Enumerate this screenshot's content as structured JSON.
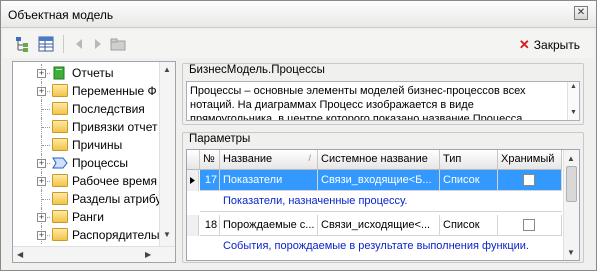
{
  "window": {
    "title": "Объектная модель",
    "close_glyph": "✕"
  },
  "toolbar": {
    "close_label": "Закрыть"
  },
  "tree": {
    "items": [
      {
        "label": "Отчеты",
        "icon": "green-book-icon",
        "expander": "+"
      },
      {
        "label": "Переменные Ф",
        "icon": "folder-icon",
        "expander": "+"
      },
      {
        "label": "Последствия",
        "icon": "folder-icon",
        "expander": ""
      },
      {
        "label": "Привязки отчет",
        "icon": "folder-icon",
        "expander": ""
      },
      {
        "label": "Причины",
        "icon": "folder-icon",
        "expander": ""
      },
      {
        "label": "Процессы",
        "icon": "process-arrow-icon",
        "expander": "+"
      },
      {
        "label": "Рабочее время",
        "icon": "folder-icon",
        "expander": "+"
      },
      {
        "label": "Разделы атрибу",
        "icon": "folder-icon",
        "expander": ""
      },
      {
        "label": "Ранги",
        "icon": "folder-icon",
        "expander": "+"
      },
      {
        "label": "Распорядителы",
        "icon": "folder-icon",
        "expander": "+"
      }
    ]
  },
  "description": {
    "title": "БизнесМодель.Процессы",
    "text": "Процессы – основные элементы моделей бизнес-процессов всех нотаций. На диаграммах Процесс изображается в виде прямоугольника, в центре которого показано название Процесса."
  },
  "params": {
    "title": "Параметры",
    "columns": [
      "№",
      "Название",
      "Системное название",
      "Тип",
      "Хранимый"
    ],
    "rows": [
      {
        "num": "17",
        "name": "Показатели",
        "sysname": "Связи_входящие<Б...",
        "type": "Список",
        "stored": false,
        "note": "Показатели, назначенные процессу.",
        "selected": true
      },
      {
        "num": "18",
        "name": "Порождаемые с...",
        "sysname": "Связи_исходящие<...",
        "type": "Список",
        "stored": false,
        "note": "События, порождаемые в результате выполнения функции.",
        "selected": false
      }
    ]
  },
  "colors": {
    "selection": "#3399ff",
    "note_text": "#0a24c8",
    "close_red": "#d51a1a"
  }
}
